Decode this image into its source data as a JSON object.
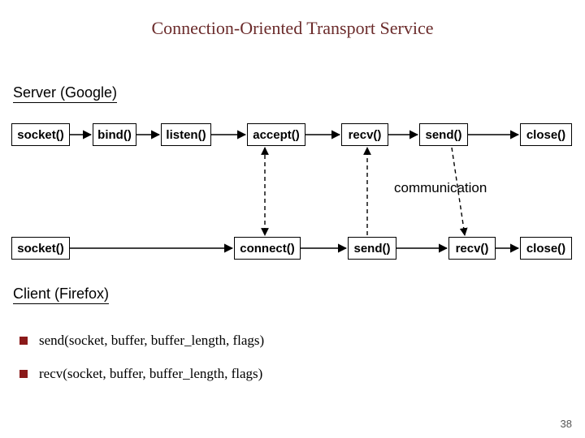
{
  "title": "Connection-Oriented Transport Service",
  "server_label": "Server (Google)",
  "client_label": "Client (Firefox)",
  "comm_label": "communication",
  "server_nodes": {
    "socket": "socket()",
    "bind": "bind()",
    "listen": "listen()",
    "accept": "accept()",
    "recv": "recv()",
    "send": "send()",
    "close": "close()"
  },
  "client_nodes": {
    "socket": "socket()",
    "connect": "connect()",
    "send": "send()",
    "recv": "recv()",
    "close": "close()"
  },
  "bullets": {
    "b1": "send(socket, buffer, buffer_length, flags)",
    "b2": "recv(socket, buffer, buffer_length, flags)"
  },
  "page_number": "38"
}
